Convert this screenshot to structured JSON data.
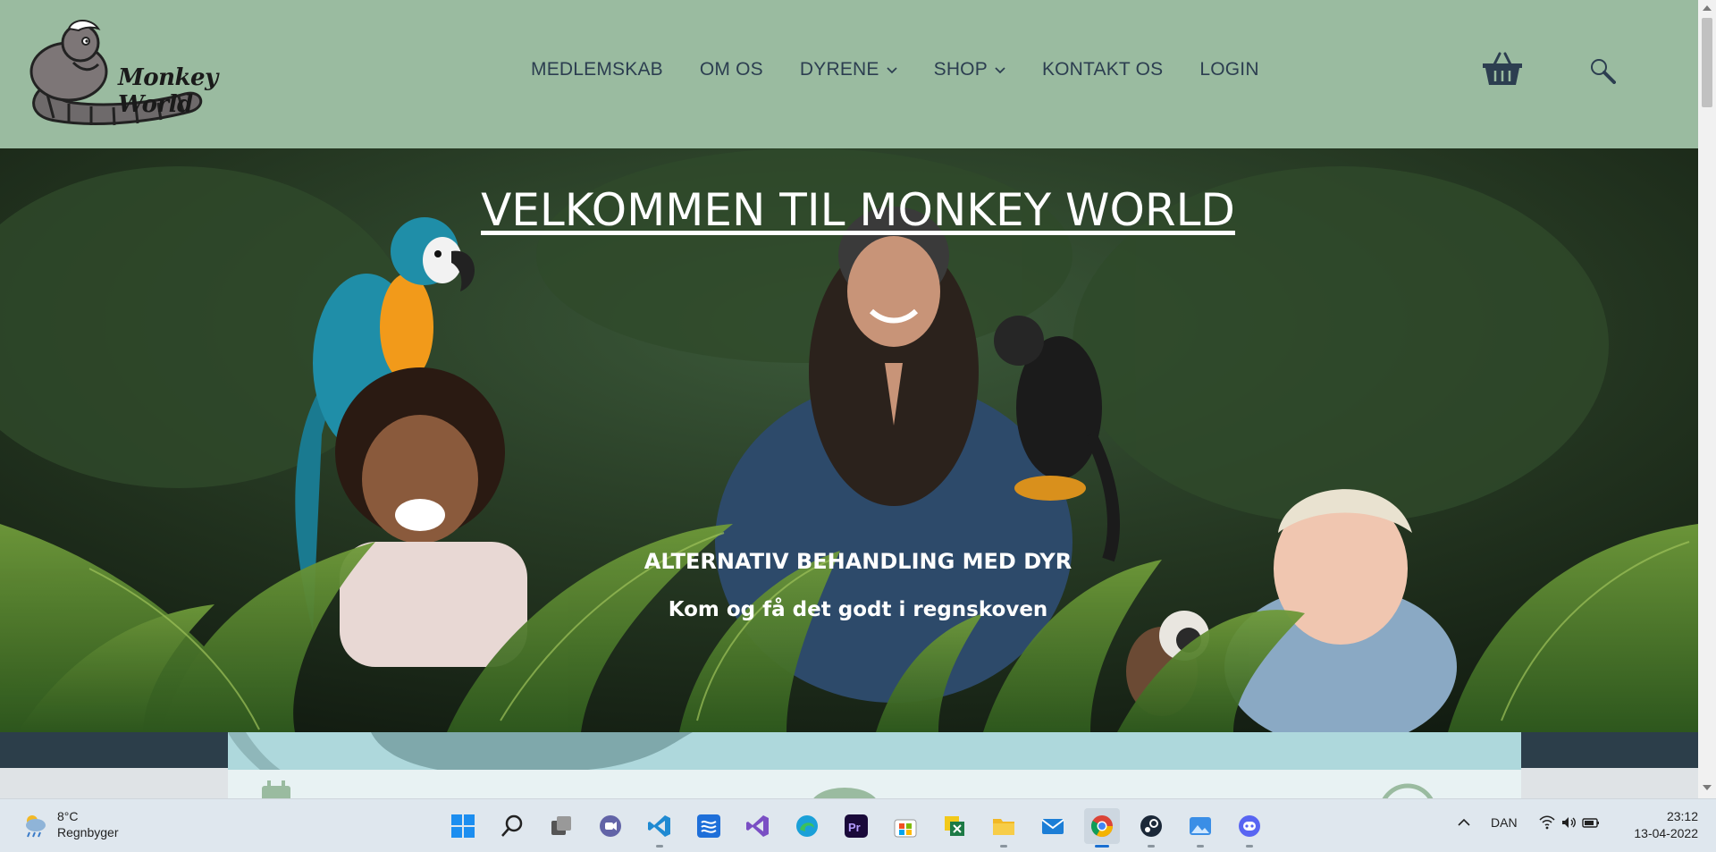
{
  "brand": {
    "name": "Monkey World"
  },
  "nav": {
    "items": [
      {
        "label": "MEDLEMSKAB",
        "dropdown": false
      },
      {
        "label": "OM OS",
        "dropdown": false
      },
      {
        "label": "DYRENE",
        "dropdown": true
      },
      {
        "label": "SHOP",
        "dropdown": true
      },
      {
        "label": "KONTAKT OS",
        "dropdown": false
      },
      {
        "label": "LOGIN",
        "dropdown": false
      }
    ]
  },
  "icons": {
    "cart": "basket-icon",
    "search": "magnifier-icon"
  },
  "hero": {
    "title": "VELKOMMEN TIL MONKEY WORLD",
    "subtitle": "ALTERNATIV BEHANDLING MED DYR",
    "tagline": "Kom og få det godt i regnskoven"
  },
  "colors": {
    "header_bg": "#9abba0",
    "nav_text": "#2c3e50",
    "band": "#2c3e4a",
    "card": "#aed8dc"
  },
  "taskbar": {
    "weather": {
      "temp": "8°C",
      "desc": "Regnbyger"
    },
    "apps": [
      "windows-start-icon",
      "search-icon",
      "task-view-icon",
      "teams-chat-icon",
      "vscode-icon",
      "azure-data-icon",
      "visual-studio-icon",
      "edge-icon",
      "premiere-icon",
      "store-icon",
      "excel-python-icon",
      "file-explorer-icon",
      "mail-icon",
      "chrome-icon",
      "steam-icon",
      "photos-icon",
      "discord-icon"
    ],
    "language": "DAN",
    "time": "23:12",
    "date": "13-04-2022"
  }
}
